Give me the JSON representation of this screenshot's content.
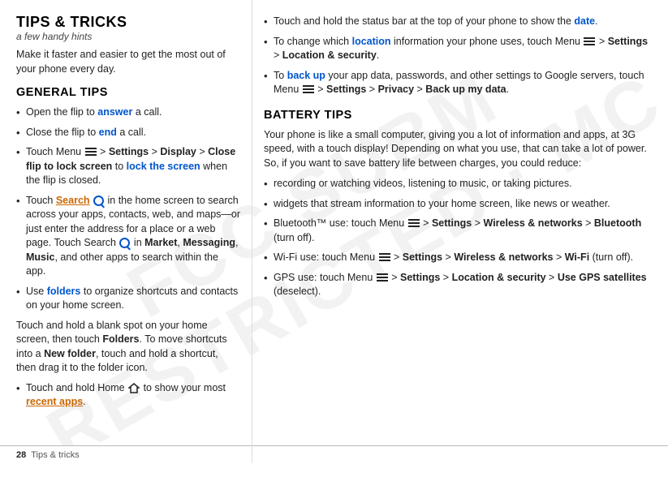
{
  "page": {
    "footer": {
      "page_num": "28",
      "label": "Tips & tricks"
    }
  },
  "left": {
    "main_title": "TIPS & TRICKS",
    "subtitle": "a few handy hints",
    "intro": "Make it faster and easier to get the most out of your phone every day.",
    "general_tips_title": "GENERAL TIPS",
    "tips": [
      {
        "id": "tip-answer",
        "text_parts": [
          {
            "text": "Open the flip to ",
            "style": "normal"
          },
          {
            "text": "answer",
            "style": "highlight-blue"
          },
          {
            "text": " a call.",
            "style": "normal"
          }
        ]
      },
      {
        "id": "tip-end",
        "text_parts": [
          {
            "text": "Close the flip to ",
            "style": "normal"
          },
          {
            "text": "end",
            "style": "highlight-blue"
          },
          {
            "text": " a call.",
            "style": "normal"
          }
        ]
      },
      {
        "id": "tip-lock",
        "text_parts": [
          {
            "text": "Touch Menu ",
            "style": "normal"
          },
          {
            "text": " > Settings > Display > ",
            "style": "bold"
          },
          {
            "text": "Close flip to lock screen",
            "style": "bold"
          },
          {
            "text": " to ",
            "style": "normal"
          },
          {
            "text": "lock the screen",
            "style": "highlight-blue"
          },
          {
            "text": " when the flip is closed.",
            "style": "normal"
          }
        ]
      },
      {
        "id": "tip-search",
        "text_parts": [
          {
            "text": "Touch ",
            "style": "normal"
          },
          {
            "text": "Search",
            "style": "highlight-orange"
          },
          {
            "text": " ",
            "style": "normal"
          },
          {
            "text": " in the home screen to search across your apps, contacts, web, and maps—or just enter the address for a place or a web page. Touch Search ",
            "style": "normal"
          },
          {
            "text": " in ",
            "style": "normal"
          },
          {
            "text": "Market",
            "style": "bold"
          },
          {
            "text": ", ",
            "style": "normal"
          },
          {
            "text": "Messaging",
            "style": "bold"
          },
          {
            "text": ", ",
            "style": "normal"
          },
          {
            "text": "Music",
            "style": "bold"
          },
          {
            "text": ", and other apps to search within the app.",
            "style": "normal"
          }
        ]
      },
      {
        "id": "tip-folders",
        "text_parts": [
          {
            "text": "Use ",
            "style": "normal"
          },
          {
            "text": "folders",
            "style": "highlight-blue"
          },
          {
            "text": " to organize shortcuts and contacts on your home screen.",
            "style": "normal"
          }
        ]
      },
      {
        "id": "tip-folders-detail",
        "is_subpara": true,
        "text": "Touch and hold a blank spot on your home screen, then touch Folders. To move shortcuts into a New folder, touch and hold a shortcut, then drag it to the folder icon."
      },
      {
        "id": "tip-recent",
        "text_parts": [
          {
            "text": "Touch and hold Home ",
            "style": "normal"
          },
          {
            "text": " to show your most ",
            "style": "normal"
          },
          {
            "text": "recent apps",
            "style": "highlight-orange"
          },
          {
            "text": ".",
            "style": "normal"
          }
        ]
      }
    ]
  },
  "right": {
    "tips_top": [
      {
        "id": "rtip-statusbar",
        "text": "Touch and hold the status bar at the top of your phone to show the date.",
        "highlight": {
          "word": "date",
          "style": "highlight-blue"
        }
      },
      {
        "id": "rtip-location",
        "text_parts": [
          {
            "text": "To change which ",
            "style": "normal"
          },
          {
            "text": "location",
            "style": "highlight-blue"
          },
          {
            "text": " information your phone uses, touch Menu ",
            "style": "normal"
          },
          {
            "text": " > Settings > ",
            "style": "bold"
          },
          {
            "text": "Location & security",
            "style": "bold"
          },
          {
            "text": ".",
            "style": "normal"
          }
        ]
      },
      {
        "id": "rtip-backup",
        "text_parts": [
          {
            "text": "To ",
            "style": "normal"
          },
          {
            "text": "back up",
            "style": "highlight-blue"
          },
          {
            "text": " your app data, passwords, and other settings to Google servers, touch Menu ",
            "style": "normal"
          },
          {
            "text": " > Settings > Privacy > ",
            "style": "bold"
          },
          {
            "text": "Back up my data",
            "style": "bold"
          },
          {
            "text": ".",
            "style": "normal"
          }
        ]
      }
    ],
    "battery_title": "BATTERY TIPS",
    "battery_intro": "Your phone is like a small computer, giving you a lot of information and apps, at 3G speed, with a touch display! Depending on what you use, that can take a lot of power. So, if you want to save battery life between charges, you could reduce:",
    "battery_tips": [
      {
        "id": "btip-recording",
        "text": "recording or watching videos, listening to music, or taking pictures."
      },
      {
        "id": "btip-widgets",
        "text": "widgets that stream information to your home screen, like news or weather."
      },
      {
        "id": "btip-bluetooth",
        "text_parts": [
          {
            "text": "Bluetooth™ use: touch Menu ",
            "style": "normal"
          },
          {
            "text": " > Settings > ",
            "style": "bold"
          },
          {
            "text": "Wireless & networks",
            "style": "bold"
          },
          {
            "text": " > ",
            "style": "bold"
          },
          {
            "text": "Bluetooth",
            "style": "bold"
          },
          {
            "text": " (turn off).",
            "style": "normal"
          }
        ]
      },
      {
        "id": "btip-wifi",
        "text_parts": [
          {
            "text": "Wi-Fi use: touch Menu ",
            "style": "normal"
          },
          {
            "text": " > Settings > ",
            "style": "bold"
          },
          {
            "text": "Wireless & networks",
            "style": "bold"
          },
          {
            "text": " > ",
            "style": "bold"
          },
          {
            "text": "Wi-Fi",
            "style": "bold"
          },
          {
            "text": " (turn off).",
            "style": "normal"
          }
        ]
      },
      {
        "id": "btip-gps",
        "text_parts": [
          {
            "text": "GPS use: touch Menu ",
            "style": "normal"
          },
          {
            "text": " > Settings > ",
            "style": "bold"
          },
          {
            "text": "Location & security",
            "style": "bold"
          },
          {
            "text": " > ",
            "style": "bold"
          },
          {
            "text": "Use GPS satellites",
            "style": "bold"
          },
          {
            "text": " (deselect).",
            "style": "normal"
          }
        ]
      }
    ]
  }
}
